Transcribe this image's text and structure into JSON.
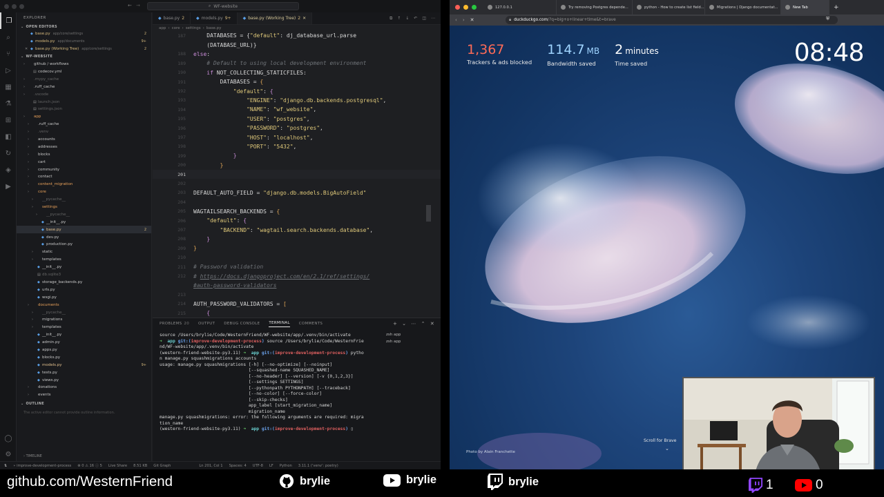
{
  "vscode": {
    "window_title": "WF-website",
    "explorer_title": "EXPLORER",
    "open_editors_label": "OPEN EDITORS",
    "open_editors": [
      {
        "name": "base.py",
        "hint": "app/core/settings",
        "badge": "2"
      },
      {
        "name": "models.py",
        "hint": "app/documents",
        "badge": "9+"
      },
      {
        "name": "base.py (Working Tree)",
        "hint": "app/core/settings",
        "badge": "2"
      }
    ],
    "project_label": "WF-WEBSITE",
    "tree": [
      {
        "label": "github / workflows",
        "kind": "folder",
        "indent": 1,
        "style": "normal"
      },
      {
        "label": "codecov.yml",
        "kind": "file",
        "indent": 2,
        "style": "normal"
      },
      {
        "label": ".mypy_cache",
        "kind": "folder",
        "indent": 1,
        "style": "dim"
      },
      {
        "label": ".ruff_cache",
        "kind": "folder",
        "indent": 1,
        "style": "normal"
      },
      {
        "label": ".vscode",
        "kind": "folder",
        "indent": 1,
        "style": "dim"
      },
      {
        "label": "launch.json",
        "kind": "file",
        "indent": 2,
        "style": "dim"
      },
      {
        "label": "settings.json",
        "kind": "file",
        "indent": 2,
        "style": "dim"
      },
      {
        "label": "app",
        "kind": "folder",
        "indent": 1,
        "style": "orange"
      },
      {
        "label": ".ruff_cache",
        "kind": "folder",
        "indent": 2,
        "style": "normal"
      },
      {
        "label": ".venv",
        "kind": "folder",
        "indent": 2,
        "style": "dim"
      },
      {
        "label": "accounts",
        "kind": "folder",
        "indent": 2,
        "style": "normal"
      },
      {
        "label": "addresses",
        "kind": "folder",
        "indent": 2,
        "style": "normal"
      },
      {
        "label": "blocks",
        "kind": "folder",
        "indent": 2,
        "style": "normal"
      },
      {
        "label": "cart",
        "kind": "folder",
        "indent": 2,
        "style": "normal"
      },
      {
        "label": "community",
        "kind": "folder",
        "indent": 2,
        "style": "normal"
      },
      {
        "label": "contact",
        "kind": "folder",
        "indent": 2,
        "style": "normal"
      },
      {
        "label": "content_migration",
        "kind": "folder",
        "indent": 2,
        "style": "orange"
      },
      {
        "label": "core",
        "kind": "folder",
        "indent": 2,
        "style": "orange"
      },
      {
        "label": "__pycache__",
        "kind": "folder",
        "indent": 3,
        "style": "dim"
      },
      {
        "label": "settings",
        "kind": "folder",
        "indent": 3,
        "style": "orange"
      },
      {
        "label": "__pycache__",
        "kind": "folder",
        "indent": 4,
        "style": "dim"
      },
      {
        "label": "__init__.py",
        "kind": "py",
        "indent": 4,
        "style": "normal"
      },
      {
        "label": "base.py",
        "kind": "py",
        "indent": 4,
        "style": "yellow",
        "badge": "2",
        "selected": true
      },
      {
        "label": "dev.py",
        "kind": "py",
        "indent": 4,
        "style": "normal"
      },
      {
        "label": "production.py",
        "kind": "py",
        "indent": 4,
        "style": "normal"
      },
      {
        "label": "static",
        "kind": "folder",
        "indent": 3,
        "style": "normal"
      },
      {
        "label": "templates",
        "kind": "folder",
        "indent": 3,
        "style": "normal"
      },
      {
        "label": "__init__.py",
        "kind": "py",
        "indent": 3,
        "style": "normal"
      },
      {
        "label": "db.sqlite3",
        "kind": "file",
        "indent": 3,
        "style": "dim"
      },
      {
        "label": "storage_backends.py",
        "kind": "py",
        "indent": 3,
        "style": "normal"
      },
      {
        "label": "urls.py",
        "kind": "py",
        "indent": 3,
        "style": "normal"
      },
      {
        "label": "wsgi.py",
        "kind": "py",
        "indent": 3,
        "style": "normal"
      },
      {
        "label": "documents",
        "kind": "folder",
        "indent": 2,
        "style": "orange"
      },
      {
        "label": "__pycache__",
        "kind": "folder",
        "indent": 3,
        "style": "dim"
      },
      {
        "label": "migrations",
        "kind": "folder",
        "indent": 3,
        "style": "normal"
      },
      {
        "label": "templates",
        "kind": "folder",
        "indent": 3,
        "style": "normal"
      },
      {
        "label": "__init__.py",
        "kind": "py",
        "indent": 3,
        "style": "normal"
      },
      {
        "label": "admin.py",
        "kind": "py",
        "indent": 3,
        "style": "normal"
      },
      {
        "label": "apps.py",
        "kind": "py",
        "indent": 3,
        "style": "normal"
      },
      {
        "label": "blocks.py",
        "kind": "py",
        "indent": 3,
        "style": "normal"
      },
      {
        "label": "models.py",
        "kind": "py",
        "indent": 3,
        "style": "yellow",
        "badge": "9+"
      },
      {
        "label": "tests.py",
        "kind": "py",
        "indent": 3,
        "style": "normal"
      },
      {
        "label": "views.py",
        "kind": "py",
        "indent": 3,
        "style": "normal"
      },
      {
        "label": "donations",
        "kind": "folder",
        "indent": 2,
        "style": "normal"
      },
      {
        "label": "events",
        "kind": "folder",
        "indent": 2,
        "style": "normal"
      }
    ],
    "outline_label": "OUTLINE",
    "outline_note": "The active editor cannot provide outline information.",
    "timeline_label": "TIMELINE",
    "tabs": [
      {
        "label": "base.py",
        "mod": "2",
        "active": false
      },
      {
        "label": "models.py",
        "mod": "9+",
        "active": false
      },
      {
        "label": "base.py (Working Tree)",
        "mod": "2",
        "active": true
      }
    ],
    "breadcrumbs": [
      "app",
      "core",
      "settings",
      "base.py"
    ],
    "status": {
      "branch": "improve-development-process",
      "problems": "⊗ 0  ⚠ 16  ⓘ 5",
      "live_share": "Live Share",
      "size": "8.51 KB",
      "git_graph": "Git Graph",
      "position": "Ln 201, Col 1",
      "spaces": "Spaces: 4",
      "encoding": "UTF-8",
      "eol": "LF",
      "language": "Python",
      "interpreter": "3.11.1 ('venv': poetry)"
    }
  },
  "editor_lines": [
    {
      "a": "187",
      "b": "187",
      "html": "    DATABASES = {<span class='k-str'>\"default\"</span>: dj_database_url.parse"
    },
    {
      "a": "",
      "b": "",
      "html": "    (DATABASE_URL)}"
    },
    {
      "a": "188",
      "b": "188",
      "html": "<span class='k-kw'>else</span>:"
    },
    {
      "a": "189",
      "b": "189",
      "html": "    <span class='k-cmt'># Default to using local development environment</span>"
    },
    {
      "a": "190",
      "b": "190",
      "html": "    <span class='k-kw'>if</span> NOT_COLLECTING_STATICFILES:"
    },
    {
      "a": "191",
      "b": "191",
      "html": "        DATABASES = <span class='k-brk'>{</span>"
    },
    {
      "a": "192",
      "b": "192",
      "html": "            <span class='k-str'>\"default\"</span>: <span class='k-kw'>{</span>"
    },
    {
      "a": "193",
      "b": "193",
      "html": "                <span class='k-str'>\"ENGINE\"</span>: <span class='k-str'>\"django.db.backends.postgresql\"</span>,"
    },
    {
      "a": "194",
      "b": "194",
      "html": "                <span class='k-str'>\"NAME\"</span>: <span class='k-str'>\"wf_website\"</span>,"
    },
    {
      "a": "195",
      "b": "195",
      "html": "                <span class='k-str'>\"USER\"</span>: <span class='k-str'>\"postgres\"</span>,"
    },
    {
      "a": "196",
      "b": "196",
      "html": "                <span class='k-str'>\"PASSWORD\"</span>: <span class='k-str'>\"postgres\"</span>,"
    },
    {
      "a": "197",
      "b": "197",
      "html": "                <span class='k-str'>\"HOST\"</span>: <span class='k-str'>\"localhost\"</span>,"
    },
    {
      "a": "198",
      "b": "198",
      "html": "                <span class='k-str'>\"PORT\"</span>: <span class='k-str'>\"5432\"</span>,"
    },
    {
      "a": "199",
      "b": "199",
      "html": "            <span class='k-kw'>}</span>"
    },
    {
      "a": "200",
      "b": "200",
      "html": "        <span class='k-brk'>}</span>"
    },
    {
      "a": "201",
      "b": "201",
      "html": "",
      "cur": true
    },
    {
      "a": "202",
      "b": "202",
      "html": ""
    },
    {
      "a": "203",
      "b": "203",
      "html": "DEFAULT_AUTO_FIELD = <span class='k-str'>\"django.db.models.BigAutoField\"</span>"
    },
    {
      "a": "204",
      "b": "204",
      "html": ""
    },
    {
      "a": "205",
      "b": "205",
      "html": "WAGTAILSEARCH_BACKENDS = <span class='k-brk'>{</span>"
    },
    {
      "a": "206",
      "b": "206",
      "html": "    <span class='k-str'>\"default\"</span>: <span class='k-kw'>{</span>"
    },
    {
      "a": "207",
      "b": "207",
      "html": "        <span class='k-str'>\"BACKEND\"</span>: <span class='k-str'>\"wagtail.search.backends.database\"</span>,"
    },
    {
      "a": "208",
      "b": "208",
      "html": "    <span class='k-kw'>}</span>"
    },
    {
      "a": "209",
      "b": "209",
      "html": "<span class='k-brk'>}</span>"
    },
    {
      "a": "210",
      "b": "210",
      "html": ""
    },
    {
      "a": "211",
      "b": "211",
      "html": "<span class='k-cmt'># Password validation</span>"
    },
    {
      "a": "212",
      "b": "212",
      "html": "<span class='k-cmt'># </span><span class='k-link'>https://docs.djangoproject.com/en/2.1/ref/settings/</span>"
    },
    {
      "a": "",
      "b": "",
      "html": "<span class='k-link'>#auth-password-validators</span>"
    },
    {
      "a": "213",
      "b": "213",
      "html": ""
    },
    {
      "a": "214",
      "b": "214",
      "html": "AUTH_PASSWORD_VALIDATORS = <span class='k-brk'>[</span>"
    },
    {
      "a": "215",
      "b": "215",
      "html": "    <span class='k-kw'>{</span>"
    }
  ],
  "panel": {
    "tabs": [
      "PROBLEMS",
      "OUTPUT",
      "DEBUG CONSOLE",
      "TERMINAL",
      "COMMENTS"
    ],
    "problems_count": "20",
    "active_tab": "TERMINAL",
    "shells": [
      "zsh  app",
      "zsh  app"
    ]
  },
  "terminal_html": "source /Users/brylie/Code/WesternFriend/WF-website/app/.venv/bin/activate\n<span class='t-arrow'>➜</span>  <span class='t-path'>app</span> <span class='t-git'>git:(</span><span class='t-branch'>improve-development-process</span><span class='t-git'>)</span> source /Users/brylie/Code/WesternFrie\nnd/WF-website/app/.venv/bin/activate\n(western-friend-website-py3.11) <span class='t-arrow'>➜</span>  <span class='t-path'>app</span> <span class='t-git'>git:(</span><span class='t-branch'>improve-development-process</span><span class='t-git'>)</span> pytho\nn manage.py squashmigrations accounts\nusage: manage.py squashmigrations [-h] [--no-optimize] [--noinput]\n                                  [--squashed-name SQUASHED_NAME]\n                                  [--no-header] [--version] [-v {0,1,2,3}]\n                                  [--settings SETTINGS]\n                                  [--pythonpath PYTHONPATH] [--traceback]\n                                  [--no-color] [--force-color]\n                                  [--skip-checks]\n                                  app_label [start_migration_name]\n                                  migration_name\nmanage.py squashmigrations: error: the following arguments are required: migra\ntion_name\n(western-friend-website-py3.11) <span class='t-arrow'>➜</span>  <span class='t-path'>app</span> <span class='t-git'>git:(</span><span class='t-branch'>improve-development-process</span><span class='t-git'>)</span> ▯",
  "browser": {
    "tabs": [
      {
        "label": "127.0.0.1",
        "active": false
      },
      {
        "label": "Try removing Postgres depende...",
        "active": false
      },
      {
        "label": "python - How to create list field...",
        "active": false
      },
      {
        "label": "Migrations | Django documentat...",
        "active": false
      },
      {
        "label": "New Tab",
        "active": true
      }
    ],
    "url_domain": "duckduckgo.com",
    "url_rest": "/?q=big+o+linear+time&t=brave",
    "stats": [
      {
        "value": "1,367",
        "unit": "",
        "caption": "Trackers & ads blocked",
        "color": "#ff6b57"
      },
      {
        "value": "114.7",
        "unit": "MB",
        "caption": "Bandwidth saved",
        "color": "#9fd4ff"
      },
      {
        "value": "2",
        "unit": "minutes",
        "caption": "Time saved",
        "color": "#ffffff"
      }
    ],
    "clock": "08:48",
    "photo_credit": "Photo by Alain Franchette",
    "scroll_hint": "Scroll for Brave"
  },
  "footer": {
    "github_url": "github.com/WesternFriend",
    "github_user": "brylie",
    "youtube_user": "brylie",
    "twitch_user": "brylie",
    "twitch_count": "1",
    "youtube_count": "0"
  }
}
